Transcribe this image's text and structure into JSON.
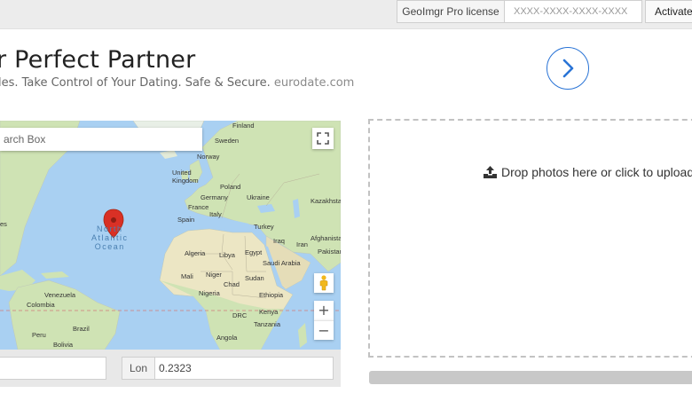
{
  "license": {
    "label": "GeoImgr Pro license",
    "placeholder": "XXXX-XXXX-XXXX-XXXX",
    "activate_label": "Activate"
  },
  "hero": {
    "title": "r Perfect Partner",
    "subtitle_text": "les. Take Control of Your Dating. Safe & Secure.",
    "subtitle_brand": "eurodate.com"
  },
  "map": {
    "search_placeholder": "arch Box",
    "ocean_label_line1": "North",
    "ocean_label_line2": "Atlantic",
    "ocean_label_line3": "Ocean",
    "labels": {
      "finland": "Finland",
      "sweden": "Sweden",
      "norway": "Norway",
      "united_kingdom": "United Kingdom",
      "poland": "Poland",
      "germany": "Germany",
      "ukraine": "Ukraine",
      "france": "France",
      "kazakhstan": "Kazakhsta",
      "italy": "Italy",
      "spain": "Spain",
      "turkey": "Turkey",
      "iraq": "Iraq",
      "iran": "Iran",
      "afghanistan": "Afghanista",
      "algeria": "Algeria",
      "libya": "Libya",
      "egypt": "Egypt",
      "saudi_arabia": "Saudi Arabia",
      "pakistan": "Pakistan",
      "mali": "Mali",
      "niger": "Niger",
      "chad": "Chad",
      "sudan": "Sudan",
      "nigeria": "Nigeria",
      "ethiopia": "Ethiopia",
      "venezuela": "Venezuela",
      "colombia": "Colombia",
      "kenya": "Kenya",
      "drc": "DRC",
      "tanzania": "Tanzania",
      "brazil": "Brazil",
      "peru": "Peru",
      "angola": "Angola",
      "bolivia": "Bolivia",
      "west_edge": "es"
    },
    "zoom_in": "+",
    "zoom_out": "−"
  },
  "coords": {
    "lon_label": "Lon",
    "lon_value": "0.2323"
  },
  "dropzone": {
    "text": "Drop photos here or click to upload"
  },
  "icons": {
    "next": "chevron-right-icon",
    "fullscreen": "fullscreen-icon",
    "pin": "map-pin-icon",
    "pegman": "pegman-icon",
    "upload": "upload-icon"
  },
  "colors": {
    "accent": "#2a74d6",
    "water": "#a9d0f2",
    "land": "#cfe3b4",
    "pin": "#d93025"
  }
}
